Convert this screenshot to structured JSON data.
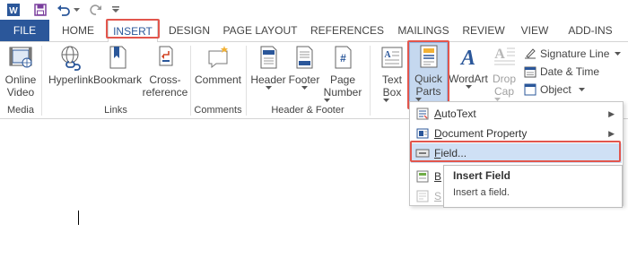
{
  "quick_access": {
    "icons": [
      "word-logo-icon",
      "save-icon",
      "undo-icon",
      "redo-icon",
      "customize-icon"
    ]
  },
  "tabs": [
    {
      "label": "FILE"
    },
    {
      "label": "HOME"
    },
    {
      "label": "INSERT"
    },
    {
      "label": "DESIGN"
    },
    {
      "label": "PAGE LAYOUT"
    },
    {
      "label": "REFERENCES"
    },
    {
      "label": "MAILINGS"
    },
    {
      "label": "REVIEW"
    },
    {
      "label": "VIEW"
    },
    {
      "label": "ADD-INS"
    }
  ],
  "active_tab": "INSERT",
  "ribbon": {
    "media": {
      "label": "Media",
      "online_video": [
        "Online",
        "Video"
      ]
    },
    "links": {
      "label": "Links",
      "hyperlink": "Hyperlink",
      "bookmark": "Bookmark",
      "cross_reference": [
        "Cross-",
        "reference"
      ]
    },
    "comments": {
      "label": "Comments",
      "comment": "Comment"
    },
    "header_footer": {
      "label": "Header & Footer",
      "header": "Header",
      "footer": "Footer",
      "page_number": [
        "Page",
        "Number"
      ]
    },
    "text": {
      "text_box": [
        "Text",
        "Box"
      ],
      "quick_parts": [
        "Quick",
        "Parts"
      ],
      "wordart": "WordArt",
      "drop_cap": [
        "Drop",
        "Cap"
      ],
      "signature_line": "Signature Line",
      "date_time": "Date & Time",
      "object": "Object"
    }
  },
  "menu": {
    "items": [
      {
        "label": "AutoText",
        "accel": "A",
        "rest": "utoText",
        "submenu": true
      },
      {
        "label": "Document Property",
        "accel": "D",
        "rest": "ocument Property",
        "submenu": true
      },
      {
        "label": "Field...",
        "accel": "F",
        "rest": "ield...",
        "submenu": false
      },
      {
        "label": "B",
        "accel": "B",
        "rest": "",
        "submenu": false
      },
      {
        "label": "S",
        "accel": "S",
        "rest": "",
        "submenu": false
      }
    ]
  },
  "tooltip": {
    "title": "Insert Field",
    "body": "Insert a field."
  },
  "colors": {
    "accent": "#2b579a",
    "highlight": "#e2564d",
    "hover": "#cfe0f5"
  }
}
